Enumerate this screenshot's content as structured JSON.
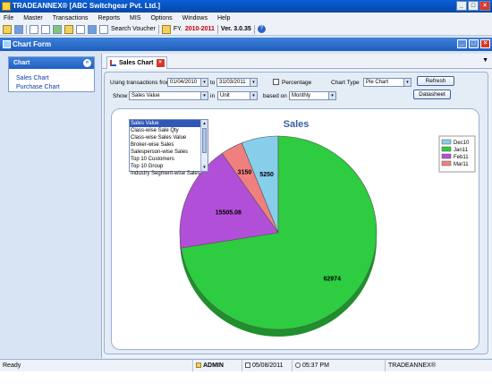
{
  "window": {
    "title": "TRADEANNEX® [ABC Switchgear Pvt. Ltd.]",
    "min": "_",
    "max": "□",
    "close": "×"
  },
  "menu": [
    "File",
    "Master",
    "Transactions",
    "Reports",
    "MIS",
    "Options",
    "Windows",
    "Help"
  ],
  "toolbar": {
    "search_voucher": "Search Voucher",
    "fy_label": "FY.",
    "fy_value": "2010-2011",
    "version": "Ver. 3.0.35",
    "help": "?"
  },
  "mdi": {
    "title": "Chart Form"
  },
  "sidebar": {
    "header": "Chart",
    "collapse": "«",
    "items": [
      {
        "label": "Sales Chart"
      },
      {
        "label": "Purchase Chart"
      }
    ]
  },
  "tab": {
    "label": "Sales Chart",
    "close": "×",
    "menu_arrow": "▼"
  },
  "form": {
    "using_label": "Using transactions from",
    "from_date": "01/04/2010",
    "to_label": "to",
    "to_date": "31/03/2011",
    "percentage_label": "Percentage",
    "chart_type_label": "Chart Type",
    "chart_type_value": "Pie Chart",
    "refresh": "Refresh",
    "show_label": "Show",
    "show_value": "Sales Value",
    "in_label": "in",
    "in_value": "Unit",
    "based_on_label": "based on",
    "based_on_value": "Monthly",
    "datasheet": "Datasheet",
    "dd_arrow": "▾"
  },
  "dropdown": {
    "options": [
      "Sales Value",
      "Class-wise Sale Qty",
      "Class-wise Sales Value",
      "Broker-wise Sales",
      "Salesperson-wise Sales",
      "Top 10 Customers",
      "Top 10 Group",
      "Industry Segment-wise Sales"
    ],
    "selected_index": 0,
    "up": "▴",
    "down": "▾"
  },
  "chart_data": {
    "type": "pie",
    "title": "Sales",
    "legend_position": "top-right",
    "slices": [
      {
        "label": "Dec10",
        "value": 5250,
        "color": "#87ceeb"
      },
      {
        "label": "Jan11",
        "value": 62974,
        "color": "#2ecc40"
      },
      {
        "label": "Feb11",
        "value": 15505.08,
        "color": "#b24fd8"
      },
      {
        "label": "Mar11",
        "value": 3150,
        "color": "#f08080"
      }
    ],
    "value_labels": [
      "5250",
      "62974",
      "15505.08",
      "3150"
    ]
  },
  "status": {
    "text": "Ready",
    "user": "ADMIN",
    "date": "05/08/2011",
    "time": "05:37 PM",
    "product": "TRADEANNEX®"
  }
}
